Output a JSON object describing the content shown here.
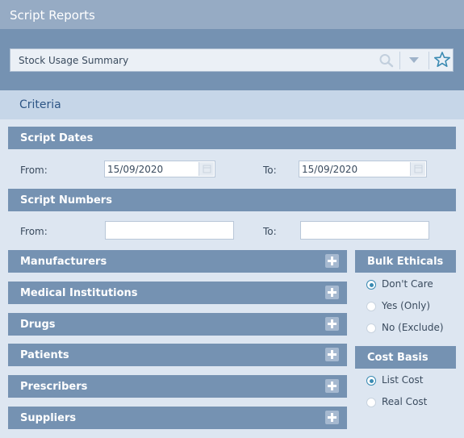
{
  "window": {
    "title": "Script Reports"
  },
  "report_selector": {
    "value": "Stock Usage Summary"
  },
  "criteria": {
    "title": "Criteria"
  },
  "script_dates": {
    "title": "Script Dates",
    "from_label": "From:",
    "from_value": "15/09/2020",
    "to_label": "To:",
    "to_value": "15/09/2020"
  },
  "script_numbers": {
    "title": "Script Numbers",
    "from_label": "From:",
    "from_value": "",
    "to_label": "To:",
    "to_value": ""
  },
  "filters": [
    {
      "label": "Manufacturers"
    },
    {
      "label": "Medical Institutions"
    },
    {
      "label": "Drugs"
    },
    {
      "label": "Patients"
    },
    {
      "label": "Prescribers"
    },
    {
      "label": "Suppliers"
    }
  ],
  "bulk_ethicals": {
    "title": "Bulk Ethicals",
    "options": [
      {
        "label": "Don't Care",
        "selected": true
      },
      {
        "label": "Yes (Only)",
        "selected": false
      },
      {
        "label": "No (Exclude)",
        "selected": false
      }
    ]
  },
  "cost_basis": {
    "title": "Cost Basis",
    "options": [
      {
        "label": "List Cost",
        "selected": true
      },
      {
        "label": "Real Cost",
        "selected": false
      }
    ]
  },
  "colors": {
    "title_bar": "#96abc4",
    "section_bar": "#7592b2",
    "accent": "#3a8ab2",
    "body_bg": "#dde6f1"
  },
  "icons": [
    "search-icon",
    "chevron-down-icon",
    "star-icon",
    "calendar-icon",
    "plus-icon"
  ]
}
